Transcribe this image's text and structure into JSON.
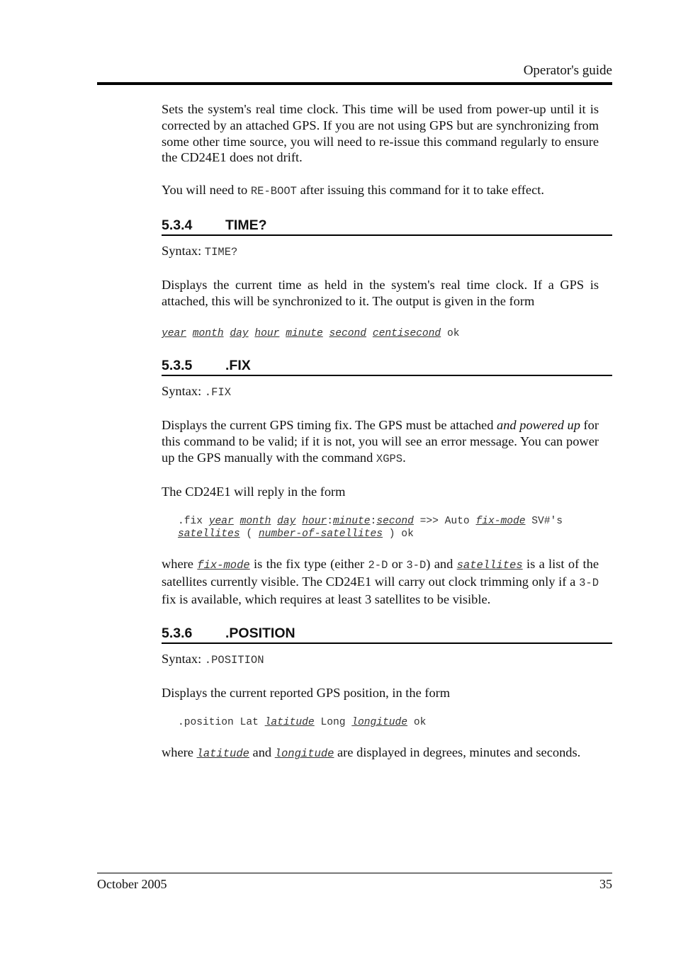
{
  "header": {
    "title": "Operator's guide"
  },
  "intro": {
    "para1": "Sets the system's real time clock. This time will be used from power-up until it is corrected by an attached GPS. If you are not using GPS but are synchronizing from some other time source, you will need to re-issue this command regularly to ensure the CD24E1 does not drift.",
    "para2_pre": "You will need to ",
    "para2_code": "RE-BOOT",
    "para2_post": " after issuing this command for it to take effect."
  },
  "sections": [
    {
      "number": "5.3.4",
      "title": "TIME?",
      "syntax_label": "Syntax: ",
      "syntax_code": "TIME?",
      "description": "Displays the current time as held in the system's real time clock. If a GPS is attached, this will be synchronized to it. The output is given in the form",
      "output_vars": [
        "year",
        "month",
        "day",
        "hour",
        "minute",
        "second",
        "centisecond"
      ],
      "output_tail": "ok"
    },
    {
      "number": "5.3.5",
      "title": ".FIX",
      "syntax_label": "Syntax: ",
      "syntax_code": ".FIX",
      "desc_pre": "Displays the current GPS timing fix. The GPS must be attached ",
      "desc_italic": "and powered up",
      "desc_mid": " for this command to be valid; if it is not, you will see an error message. You can power up the GPS manually with the command ",
      "desc_code": "XGPS",
      "desc_post": ".",
      "reply_intro": "The CD24E1 will reply in the form",
      "reply": {
        "prefix": ".fix",
        "year": "year",
        "month": "month",
        "day": "day",
        "hour": "hour",
        "minute": "minute",
        "second": "second",
        "arrow": "=>> Auto",
        "fix_mode": "fix-mode",
        "sv": "SV#'s",
        "satellites": "satellites",
        "open": "(",
        "count": "number-of-satellites",
        "close": ") ok"
      },
      "where": {
        "w1": "where ",
        "v1": "fix-mode",
        "w2": " is the fix type (either ",
        "c1": "2-D",
        "w3": " or ",
        "c2": "3-D",
        "w4": ") and ",
        "v2": "satellites",
        "w5": " is a list of the satellites currently visible. The CD24E1 will carry out clock trimming only if a ",
        "c3": "3-D",
        "w6": " fix is available, which requires at least 3 satellites to be visible."
      }
    },
    {
      "number": "5.3.6",
      "title": ".POSITION",
      "syntax_label": "Syntax: ",
      "syntax_code": ".POSITION",
      "description": "Displays the current reported GPS position, in the form",
      "reply": {
        "prefix": ".position Lat",
        "lat": "latitude",
        "mid": "Long",
        "long": "longitude",
        "tail": "ok"
      },
      "where": {
        "w1": "where ",
        "v1": "latitude",
        "w2": " and ",
        "v2": "longitude",
        "w3": " are displayed in degrees, minutes and seconds."
      }
    }
  ],
  "footer": {
    "date": "October 2005",
    "page": "35"
  }
}
